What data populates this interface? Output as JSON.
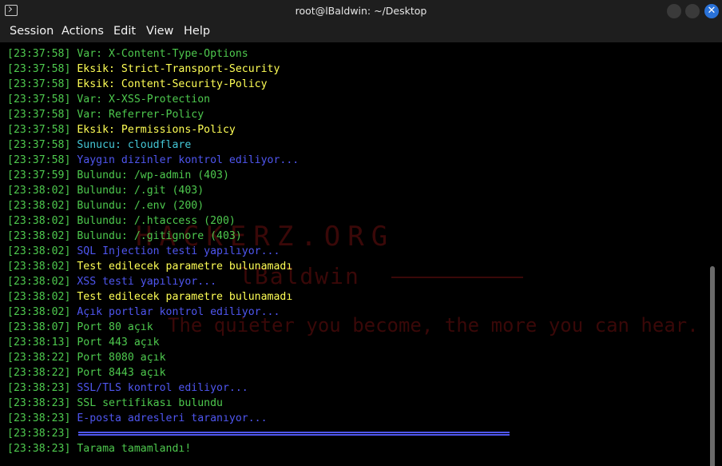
{
  "window": {
    "title": "root@lBaldwin: ~/Desktop",
    "icon": "terminal-icon",
    "controls": [
      "minimize-icon",
      "maximize-icon",
      "close-icon"
    ],
    "close_glyph": "✕"
  },
  "menu": {
    "session": "Session",
    "actions": "Actions",
    "edit": "Edit",
    "view": "View",
    "help": "Help"
  },
  "watermark": {
    "brand": "HACKERZ.ORG",
    "name": "lBaldwin",
    "motto": "The quieter you become, the more you can hear."
  },
  "colors": {
    "timestamp": "#4ec94e",
    "green": "#4ec94e",
    "yellow": "#ffff55",
    "cyan": "#44c7d6",
    "blue": "#4f56f0",
    "close_button": "#2a72d8"
  },
  "lines": [
    {
      "ts": "[23:37:58]",
      "msg": "Var: X-Content-Type-Options",
      "color": "green"
    },
    {
      "ts": "[23:37:58]",
      "msg": "Eksik: Strict-Transport-Security",
      "color": "yellow"
    },
    {
      "ts": "[23:37:58]",
      "msg": "Eksik: Content-Security-Policy",
      "color": "yellow"
    },
    {
      "ts": "[23:37:58]",
      "msg": "Var: X-XSS-Protection",
      "color": "green"
    },
    {
      "ts": "[23:37:58]",
      "msg": "Var: Referrer-Policy",
      "color": "green"
    },
    {
      "ts": "[23:37:58]",
      "msg": "Eksik: Permissions-Policy",
      "color": "yellow"
    },
    {
      "ts": "[23:37:58]",
      "msg": "Sunucu: cloudflare",
      "color": "cyan"
    },
    {
      "ts": "[23:37:58]",
      "msg": "Yaygın dizinler kontrol ediliyor...",
      "color": "blue"
    },
    {
      "ts": "[23:37:59]",
      "msg": "Bulundu: /wp-admin (403)",
      "color": "green"
    },
    {
      "ts": "[23:38:02]",
      "msg": "Bulundu: /.git (403)",
      "color": "green"
    },
    {
      "ts": "[23:38:02]",
      "msg": "Bulundu: /.env (200)",
      "color": "green"
    },
    {
      "ts": "[23:38:02]",
      "msg": "Bulundu: /.htaccess (200)",
      "color": "green"
    },
    {
      "ts": "[23:38:02]",
      "msg": "Bulundu: /.gitignore (403)",
      "color": "green"
    },
    {
      "ts": "[23:38:02]",
      "msg": "SQL Injection testi yapılıyor...",
      "color": "blue"
    },
    {
      "ts": "[23:38:02]",
      "msg": "Test edilecek parametre bulunamadı",
      "color": "yellow"
    },
    {
      "ts": "[23:38:02]",
      "msg": "XSS testi yapılıyor...",
      "color": "blue"
    },
    {
      "ts": "[23:38:02]",
      "msg": "Test edilecek parametre bulunamadı",
      "color": "yellow"
    },
    {
      "ts": "[23:38:02]",
      "msg": "Açık portlar kontrol ediliyor...",
      "color": "blue"
    },
    {
      "ts": "[23:38:07]",
      "msg": "Port 80 açık",
      "color": "green"
    },
    {
      "ts": "[23:38:13]",
      "msg": "Port 443 açık",
      "color": "green"
    },
    {
      "ts": "[23:38:22]",
      "msg": "Port 8080 açık",
      "color": "green"
    },
    {
      "ts": "[23:38:22]",
      "msg": "Port 8443 açık",
      "color": "green"
    },
    {
      "ts": "[23:38:23]",
      "msg": "SSL/TLS kontrol ediliyor...",
      "color": "blue"
    },
    {
      "ts": "[23:38:23]",
      "msg": "SSL sertifikası bulundu",
      "color": "green"
    },
    {
      "ts": "[23:38:23]",
      "msg": "E-posta adresleri taranıyor...",
      "color": "blue"
    },
    {
      "ts": "[23:38:23]",
      "msg": "",
      "color": "blue",
      "separator": true
    },
    {
      "ts": "[23:38:23]",
      "msg": "Tarama tamamlandı!",
      "color": "green"
    }
  ]
}
